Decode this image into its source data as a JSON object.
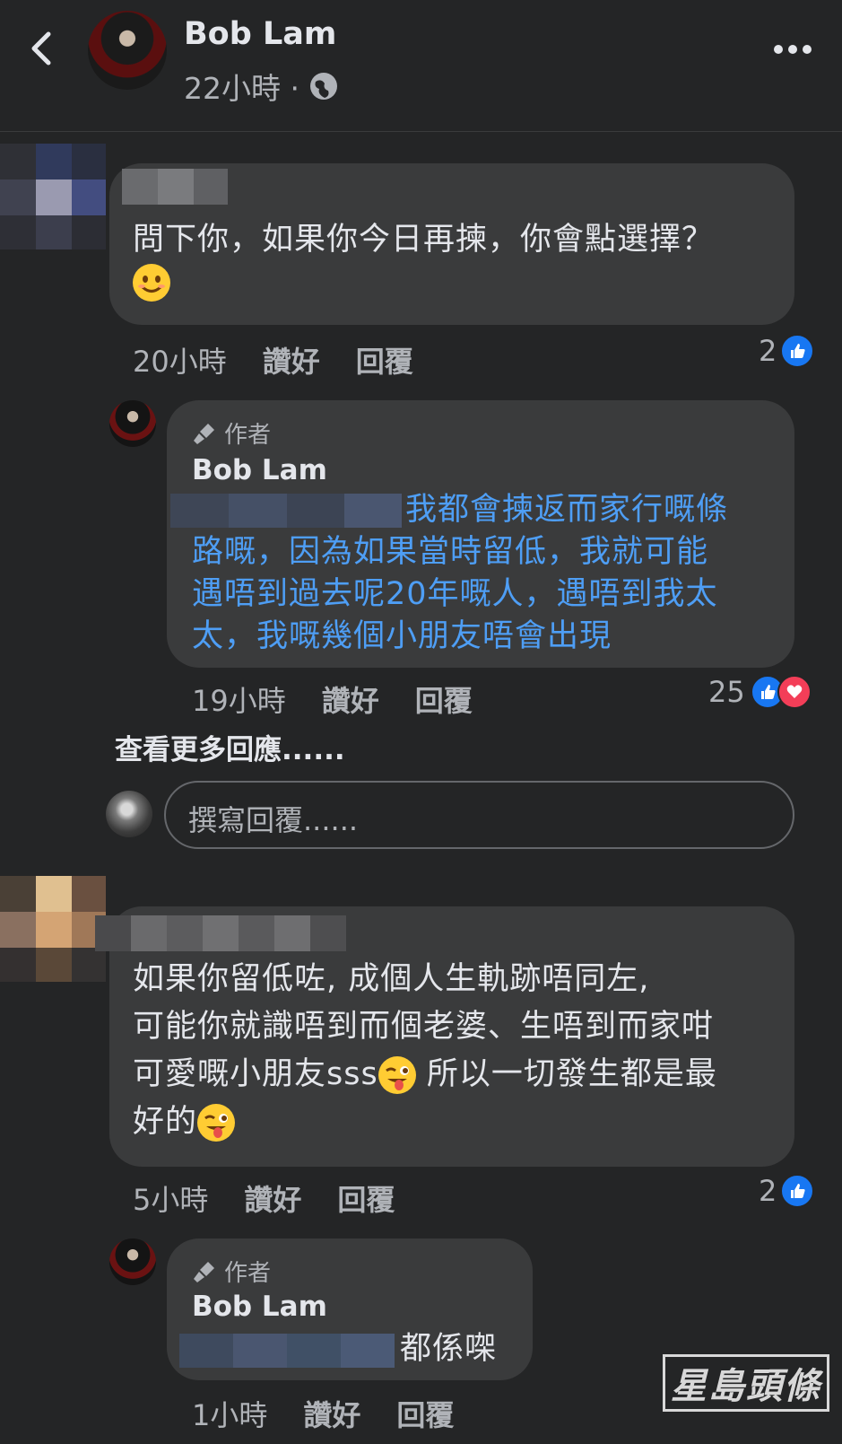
{
  "header": {
    "name": "Bob Lam",
    "time": "22小時 ·"
  },
  "comments": [
    {
      "text": "問下你，如果你今日再揀，你會點選擇？",
      "time": "20小時",
      "like": "讚好",
      "reply": "回覆",
      "reactions": "2",
      "reply_item": {
        "badge": "作者",
        "name": "Bob Lam",
        "lines": [
          "我都會揀返而家行嘅條",
          "路嘅，因為如果當時留低，我就可能",
          "遇唔到過去呢20年嘅人，遇唔到我太",
          "太，我嘅幾個小朋友唔會出現"
        ],
        "time": "19小時",
        "like": "讚好",
        "reply": "回覆",
        "reactions": "25"
      }
    },
    {
      "lines": [
        "如果你留低咗, 成個人生軌跡唔同左,",
        "可能你就識唔到而個老婆、生唔到而家咁",
        "可愛嘅小朋友sss",
        " 所以一切發生都是最",
        "好的"
      ],
      "time": "5小時",
      "like": "讚好",
      "reply": "回覆",
      "reactions": "2",
      "reply_item": {
        "badge": "作者",
        "name": "Bob Lam",
        "text": "都係㗎",
        "time": "1小時",
        "like": "讚好",
        "reply": "回覆"
      }
    }
  ],
  "more_replies": "查看更多回應......",
  "reply_placeholder": "撰寫回覆......",
  "watermark": "星島頭條",
  "colors": {
    "background": "#242526",
    "bubble": "#3a3b3c",
    "link": "#4e9ef5",
    "like": "#1877f2",
    "love": "#f33e58"
  }
}
